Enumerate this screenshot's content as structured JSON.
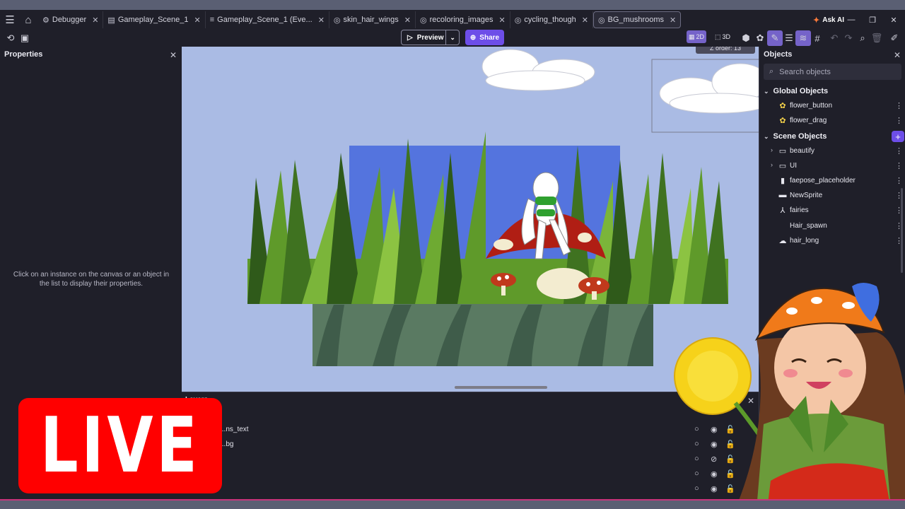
{
  "tabs": [
    {
      "label": "Debugger",
      "icon": "bug-icon"
    },
    {
      "label": "Gameplay_Scene_1",
      "icon": "film-icon"
    },
    {
      "label": "Gameplay_Scene_1 (Eve...",
      "icon": "events-icon"
    },
    {
      "label": "skin_hair_wings",
      "icon": "extension-icon"
    },
    {
      "label": "recoloring_images",
      "icon": "extension-icon"
    },
    {
      "label": "cycling_though",
      "icon": "extension-icon"
    },
    {
      "label": "BG_mushrooms",
      "icon": "extension-icon",
      "active": true
    }
  ],
  "window": {
    "ask_ai_label": "Ask AI"
  },
  "toolbar": {
    "preview_label": "Preview",
    "share_label": "Share",
    "mode_2d": "2D",
    "mode_3d": "3D"
  },
  "properties": {
    "title": "Properties",
    "hint": "Click on an instance on the canvas or an object in the list to display their properties."
  },
  "canvas": {
    "zorder_text": "Z order: 13"
  },
  "layers": {
    "title": "Layers",
    "rows": [
      {
        "name": "...ns_text"
      },
      {
        "name": "...bg"
      },
      {
        "name": ""
      },
      {
        "name": ""
      },
      {
        "name": ""
      }
    ]
  },
  "objects": {
    "title": "Objects",
    "search_placeholder": "Search objects",
    "global_title": "Global Objects",
    "global_items": [
      {
        "label": "flower_button",
        "icon": "flower-icon"
      },
      {
        "label": "flower_drag",
        "icon": "flower-icon"
      }
    ],
    "scene_title": "Scene Objects",
    "scene_items": [
      {
        "label": "beautify",
        "icon": "folder-icon",
        "expandable": true
      },
      {
        "label": "UI",
        "icon": "folder-icon",
        "expandable": true
      },
      {
        "label": "faepose_placeholder",
        "icon": "sprite-icon"
      },
      {
        "label": "NewSprite",
        "icon": "sprite-icon"
      },
      {
        "label": "fairies",
        "icon": "skeleton-icon"
      },
      {
        "label": "Hair_spawn",
        "icon": "none"
      },
      {
        "label": "hair_long",
        "icon": "hair-icon"
      }
    ]
  },
  "overlay": {
    "live_label": "LIVE"
  },
  "colors": {
    "accent": "#6d4ee8",
    "live_red": "#ff0000",
    "canvas_bg": "#aabbe4"
  }
}
